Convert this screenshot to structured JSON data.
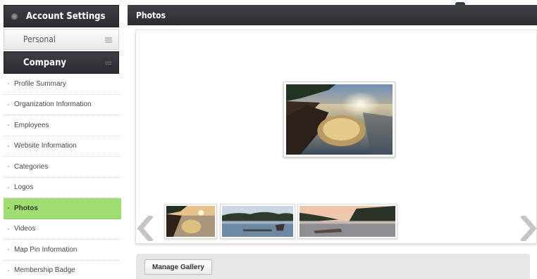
{
  "sidebar": {
    "header": "Account Settings",
    "personal": "Personal",
    "company": "Company",
    "items": [
      {
        "label": "Profile Summary"
      },
      {
        "label": "Organization Information"
      },
      {
        "label": "Employees"
      },
      {
        "label": "Website Information"
      },
      {
        "label": "Categories"
      },
      {
        "label": "Logos"
      },
      {
        "label": "Photos",
        "active": true
      },
      {
        "label": "Videos"
      },
      {
        "label": "Map Pin Information"
      },
      {
        "label": "Membership Badge"
      }
    ]
  },
  "main": {
    "title": "Photos",
    "manage_label": "Manage Gallery"
  },
  "colors": {
    "header_dark": "#2f3136",
    "active_item": "#9fdd74",
    "toolbar": "#e6e6e6"
  },
  "icons": {
    "account": "gear-icon",
    "personal": "hamburger-icon",
    "company": "grid-icon",
    "prev": "chevron-left-icon",
    "next": "chevron-right-icon"
  }
}
